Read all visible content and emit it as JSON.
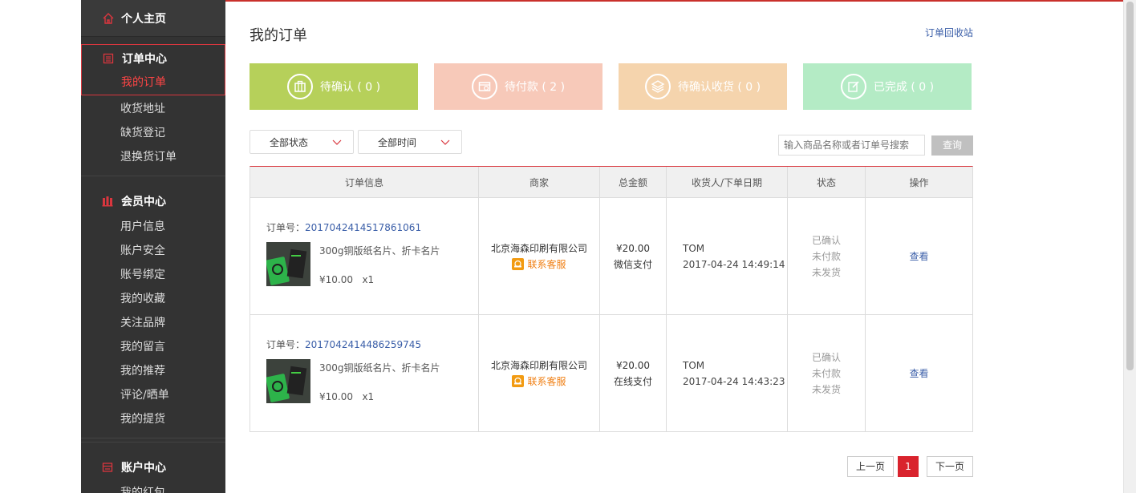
{
  "sidebar": {
    "home": "个人主页",
    "groups": [
      {
        "title": "订单中心",
        "items": [
          "我的订单",
          "收货地址",
          "缺货登记",
          "退换货订单"
        ]
      },
      {
        "title": "会员中心",
        "items": [
          "用户信息",
          "账户安全",
          "账号绑定",
          "我的收藏",
          "关注品牌",
          "我的留言",
          "我的推荐",
          "评论/晒单",
          "我的提货"
        ]
      },
      {
        "title": "账户中心",
        "items": [
          "我的红包"
        ]
      }
    ],
    "accent_color": "#d9363e"
  },
  "main": {
    "title": "我的订单",
    "recycle_link": "订单回收站",
    "stats": [
      {
        "label": "待确认 ( 0 )",
        "color": "#b6d05a",
        "icon": "briefcase-icon"
      },
      {
        "label": "待付款 ( 2 )",
        "color": "#f7c9b9",
        "icon": "wallet-icon"
      },
      {
        "label": "待确认收货 ( 0 )",
        "color": "#f5d4ad",
        "icon": "box-icon"
      },
      {
        "label": "已完成 ( 0 )",
        "color": "#b4ebc5",
        "icon": "edit-icon"
      }
    ],
    "filters": {
      "status": "全部状态",
      "time": "全部时间"
    },
    "search": {
      "placeholder": "输入商品名称或者订单号搜索",
      "button": "查询"
    },
    "table": {
      "headers": [
        "订单信息",
        "商家",
        "总金额",
        "收货人/下单日期",
        "状态",
        "操作"
      ],
      "rows": [
        {
          "order_label": "订单号：",
          "order_no": "2017042414517861061",
          "product": "300g铜版纸名片、折卡名片",
          "price": "¥10.00",
          "qty": "x1",
          "merchant": "北京海森印刷有限公司",
          "contact": "联系客服",
          "total": "¥20.00",
          "pay": "微信支付",
          "receiver": "TOM",
          "date": "2017-04-24 14:49:14",
          "status": [
            "已确认",
            "未付款",
            "未发货"
          ],
          "action": "查看"
        },
        {
          "order_label": "订单号：",
          "order_no": "2017042414486259745",
          "product": "300g铜版纸名片、折卡名片",
          "price": "¥10.00",
          "qty": "x1",
          "merchant": "北京海森印刷有限公司",
          "contact": "联系客服",
          "total": "¥20.00",
          "pay": "在线支付",
          "receiver": "TOM",
          "date": "2017-04-24 14:43:23",
          "status": [
            "已确认",
            "未付款",
            "未发货"
          ],
          "action": "查看"
        }
      ]
    },
    "pager": {
      "prev": "上一页",
      "current": "1",
      "next": "下一页"
    }
  }
}
